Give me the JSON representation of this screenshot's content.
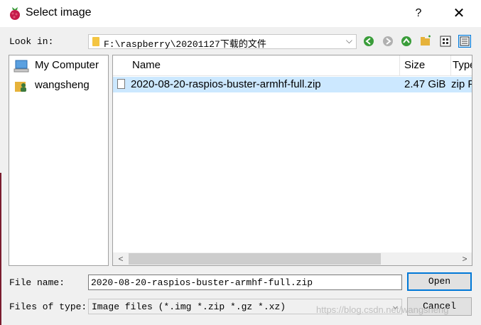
{
  "window": {
    "title": "Select image",
    "help": "?",
    "close": "✕"
  },
  "lookin": {
    "label": "Look in:",
    "path": "F:\\raspberry\\20201127下载的文件"
  },
  "places": [
    {
      "label": "My Computer",
      "icon": "computer-icon"
    },
    {
      "label": "wangsheng",
      "icon": "user-folder-icon"
    }
  ],
  "table": {
    "columns": [
      "Name",
      "Size",
      "Type"
    ],
    "rows": [
      {
        "name": "2020-08-20-raspios-buster-armhf-full.zip",
        "size": "2.47 GiB",
        "type": "zip File"
      }
    ]
  },
  "filename": {
    "label": "File name:",
    "value": "2020-08-20-raspios-buster-armhf-full.zip"
  },
  "filetype": {
    "label": "Files of type:",
    "value": "Image files (*.img *.zip *.gz *.xz)"
  },
  "buttons": {
    "open": "Open",
    "cancel": "Cancel"
  },
  "watermark": "https://blog.csdn.net/wangsheng",
  "colors": {
    "selection": "#cce8ff",
    "accent": "#0078d7"
  }
}
